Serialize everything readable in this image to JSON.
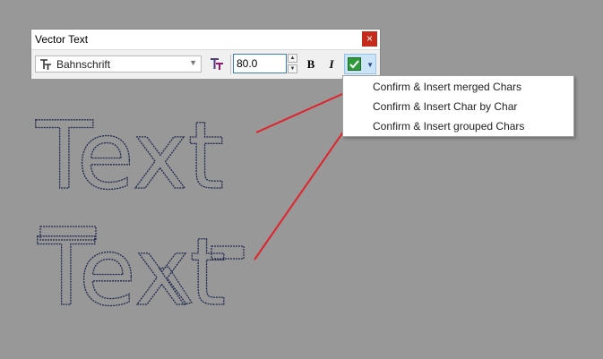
{
  "dialog": {
    "title": "Vector Text",
    "close_label": "×",
    "font_name": "Bahnschrift",
    "size_value": "80.0",
    "bold_label": "B",
    "italic_label": "I"
  },
  "menu": {
    "items": [
      {
        "label": "Confirm & Insert merged Chars"
      },
      {
        "label": "Confirm & Insert Char by Char"
      },
      {
        "label": "Confirm & Insert grouped Chars"
      }
    ]
  },
  "canvas": {
    "sample_text_merged": "Text",
    "sample_text_char_by_char": "Text"
  },
  "colors": {
    "background": "#989898",
    "outline": "#1f2a4f",
    "annotation_arrow": "#e0222a"
  }
}
